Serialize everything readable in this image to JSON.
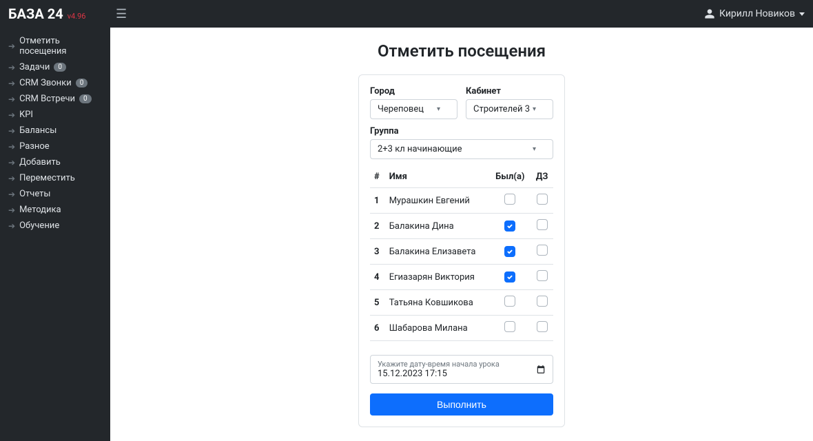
{
  "brand": {
    "name": "БАЗА 24",
    "version": "v4.96"
  },
  "user": {
    "name": "Кирилл Новиков"
  },
  "sidebar": {
    "items": [
      {
        "label": "Отметить посещения",
        "badge": null
      },
      {
        "label": "Задачи",
        "badge": "0"
      },
      {
        "label": "CRM Звонки",
        "badge": "0"
      },
      {
        "label": "CRM Встречи",
        "badge": "0"
      },
      {
        "label": "KPI",
        "badge": null
      },
      {
        "label": "Балансы",
        "badge": null
      },
      {
        "label": "Разное",
        "badge": null
      },
      {
        "label": "Добавить",
        "badge": null
      },
      {
        "label": "Переместить",
        "badge": null
      },
      {
        "label": "Отчеты",
        "badge": null
      },
      {
        "label": "Методика",
        "badge": null
      },
      {
        "label": "Обучение",
        "badge": null
      }
    ]
  },
  "page": {
    "title": "Отметить посещения",
    "filters": {
      "city_label": "Город",
      "city_value": "Череповец",
      "room_label": "Кабинет",
      "room_value": "Строителей 3",
      "group_label": "Группа",
      "group_value": "2+3 кл начинающие"
    },
    "table": {
      "headers": {
        "num": "#",
        "name": "Имя",
        "present": "Был(а)",
        "homework": "ДЗ"
      },
      "rows": [
        {
          "num": "1",
          "name": "Мурашкин Евгений",
          "present": false,
          "homework": false
        },
        {
          "num": "2",
          "name": "Балакина Дина",
          "present": true,
          "homework": false
        },
        {
          "num": "3",
          "name": "Балакина Елизавета",
          "present": true,
          "homework": false
        },
        {
          "num": "4",
          "name": "Егиазарян Виктория",
          "present": true,
          "homework": false
        },
        {
          "num": "5",
          "name": "Татьяна Ковшикова",
          "present": false,
          "homework": false
        },
        {
          "num": "6",
          "name": "Шабарова Милана",
          "present": false,
          "homework": false
        }
      ]
    },
    "datetime": {
      "label": "Укажите дату-время начала урока",
      "value": "15.12.2023 17:15"
    },
    "submit_label": "Выполнить"
  }
}
